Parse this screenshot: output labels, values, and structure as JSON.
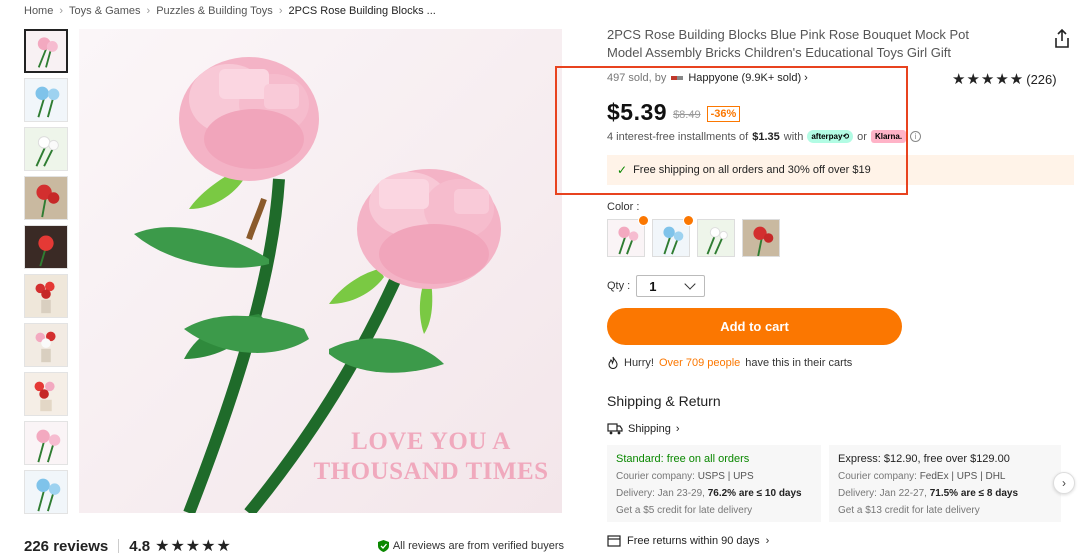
{
  "breadcrumb": {
    "items": [
      "Home",
      "Toys & Games",
      "Puzzles & Building Toys",
      "2PCS Rose Building Blocks ..."
    ],
    "separator": "›"
  },
  "product": {
    "title": "2PCS Rose Building Blocks Blue Pink Rose Bouquet Mock Pot Model Assembly Bricks Children's Educational Toys Girl Gift",
    "sold_text": "497 sold, by",
    "store_name": "Happyone (9.9K+ sold)",
    "store_chevron": "›",
    "rating_stars": "★★★★★",
    "rating_count": "(226)",
    "price": "$5.39",
    "old_price": "$8.49",
    "discount": "-36%",
    "installments_prefix": "4 interest-free installments of",
    "installments_amount": "$1.35",
    "installments_with": "with",
    "afterpay_label": "afterpay⟲",
    "or_label": "or",
    "klarna_label": "Klarna.",
    "info_symbol": "i",
    "free_shipping": "Free shipping on all orders and 30% off over $19",
    "check_symbol": "✓"
  },
  "image": {
    "caption_line1": "LOVE YOU A",
    "caption_line2": "THOUSAND TIMES"
  },
  "color": {
    "label": "Color :",
    "swatches": [
      "pink-rose",
      "blue-rose",
      "white-rose",
      "red-rose"
    ]
  },
  "quantity": {
    "label": "Qty :",
    "value": "1"
  },
  "cart": {
    "add_label": "Add to cart",
    "hurry_prefix": "Hurry!",
    "hurry_highlight": "Over 709 people",
    "hurry_suffix": "have this in their carts"
  },
  "shipping": {
    "title": "Shipping & Return",
    "link_label": "Shipping",
    "link_chevron": "›",
    "standard": {
      "head": "Standard: free on all orders",
      "courier_label": "Courier company:",
      "couriers": "USPS  |  UPS",
      "delivery_label": "Delivery: Jan 23-29,",
      "delivery_rate": "76.2% are ≤ 10 days",
      "credit": "Get a $5 credit for late delivery"
    },
    "express": {
      "head": "Express: $12.90, free over $129.00",
      "courier_label": "Courier company:",
      "couriers": "FedEx  |  UPS  |  DHL",
      "delivery_label": "Delivery: Jan 22-27,",
      "delivery_rate": "71.5% are ≤ 8 days",
      "credit": "Get a $13 credit for late delivery"
    },
    "scroll_symbol": "›",
    "returns_label": "Free returns within 90 days",
    "returns_chevron": "›"
  },
  "reviews": {
    "count_label": "226 reviews",
    "score": "4.8",
    "stars": "★★★★★",
    "verified": "All reviews are from verified buyers"
  },
  "colors": {
    "accent": "#fb7701",
    "highlight_border": "#e8431f",
    "green": "#0a8800",
    "banner_bg": "#fff3e8"
  }
}
